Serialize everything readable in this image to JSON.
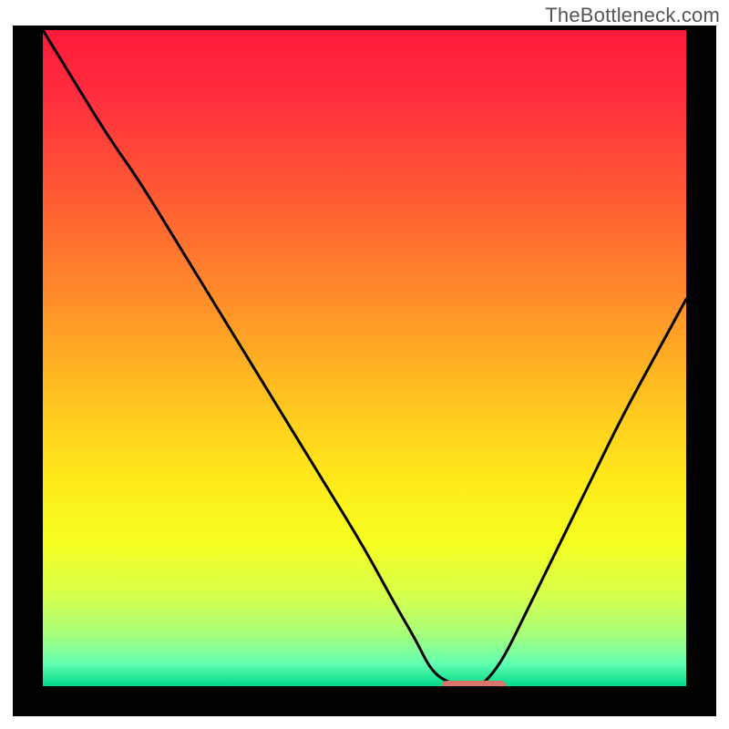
{
  "attribution": "TheBottleneck.com",
  "colors": {
    "frame": "#000000",
    "marker": "#d9746a",
    "curve": "#000000",
    "gradient_stops": [
      {
        "offset": 0.0,
        "color": "#ff1a3a"
      },
      {
        "offset": 0.1,
        "color": "#ff2d3e"
      },
      {
        "offset": 0.25,
        "color": "#ff5a34"
      },
      {
        "offset": 0.4,
        "color": "#ff8a2a"
      },
      {
        "offset": 0.55,
        "color": "#ffbf20"
      },
      {
        "offset": 0.68,
        "color": "#ffe81a"
      },
      {
        "offset": 0.78,
        "color": "#f6ff20"
      },
      {
        "offset": 0.86,
        "color": "#d7ff4a"
      },
      {
        "offset": 0.92,
        "color": "#a8ff7a"
      },
      {
        "offset": 0.965,
        "color": "#64ffb1"
      },
      {
        "offset": 1.0,
        "color": "#00d88a"
      }
    ]
  },
  "chart_data": {
    "type": "line",
    "title": "",
    "xlabel": "",
    "ylabel": "",
    "xlim": [
      0,
      100
    ],
    "ylim": [
      0,
      100
    ],
    "x": [
      0,
      5,
      10,
      15,
      20,
      25,
      30,
      35,
      40,
      45,
      50,
      55,
      58,
      60,
      62,
      65,
      68,
      70,
      72,
      75,
      80,
      85,
      90,
      95,
      100
    ],
    "series": [
      {
        "name": "bottleneck-curve",
        "values": [
          100,
          92,
          84,
          77,
          69,
          61,
          53,
          45,
          37,
          29,
          21,
          12,
          7,
          3,
          1,
          0,
          0,
          2,
          5,
          11,
          21,
          31,
          41,
          50,
          59
        ]
      }
    ],
    "optimal_range_x": [
      62,
      72
    ],
    "optimal_y": 0,
    "annotations": []
  },
  "plot": {
    "interior_w": 706,
    "interior_h": 720
  }
}
